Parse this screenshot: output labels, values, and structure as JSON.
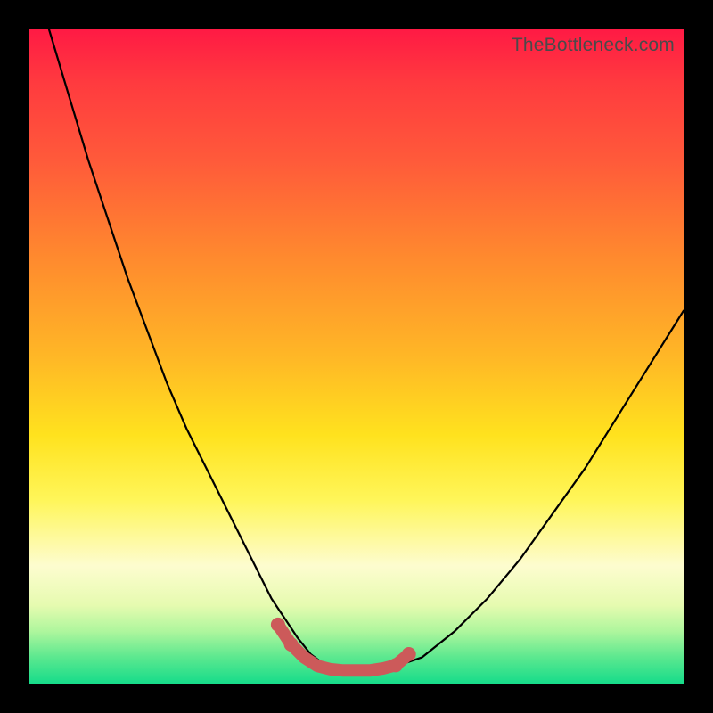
{
  "watermark": "TheBottleneck.com",
  "colors": {
    "frame": "#000000",
    "curve": "#000000",
    "bumps": "#cc5a5a",
    "gradient_top": "#ff1a44",
    "gradient_bottom": "#16dc8a"
  },
  "chart_data": {
    "type": "line",
    "title": "",
    "xlabel": "",
    "ylabel": "",
    "xlim": [
      0,
      100
    ],
    "ylim": [
      0,
      100
    ],
    "grid": false,
    "legend": false,
    "note": "No axis labels or tick marks are visible; values are normalized 0–100 estimates read from pixel positions inside the plot area. y=100 is top, y=0 is bottom.",
    "series": [
      {
        "name": "curve",
        "stroke": "#000000",
        "x": [
          3,
          6,
          9,
          12,
          15,
          18,
          21,
          24,
          27,
          30,
          33,
          35,
          37,
          39,
          41,
          43,
          45,
          47,
          49,
          51,
          55,
          60,
          65,
          70,
          75,
          80,
          85,
          90,
          95,
          100
        ],
        "y": [
          100,
          90,
          80,
          71,
          62,
          54,
          46,
          39,
          33,
          27,
          21,
          17,
          13,
          10,
          7,
          4.5,
          3,
          2.2,
          2,
          2,
          2.3,
          4,
          8,
          13,
          19,
          26,
          33,
          41,
          49,
          57
        ]
      },
      {
        "name": "highlight-flat-minimum",
        "stroke": "#cc5a5a",
        "x": [
          38,
          40,
          42,
          44,
          46,
          48,
          50,
          52,
          54,
          56,
          58
        ],
        "y": [
          9,
          6,
          4,
          2.7,
          2.2,
          2,
          2,
          2,
          2.3,
          2.8,
          4.5
        ]
      }
    ]
  }
}
